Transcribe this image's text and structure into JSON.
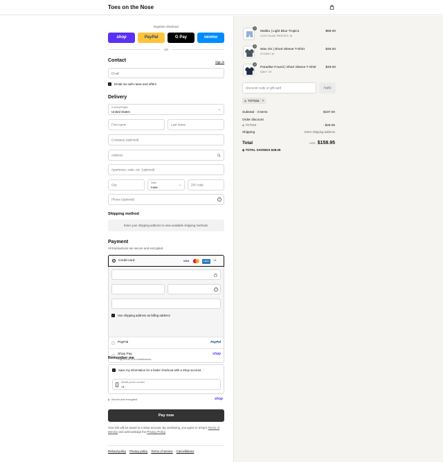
{
  "header": {
    "brand": "Toes on the Nose",
    "cart_icon": "shopping-bag-icon"
  },
  "express": {
    "label": "Express checkout",
    "buttons": [
      {
        "label": "shop",
        "color": "#5a31f4"
      },
      {
        "label": "PayPal",
        "color": "#ffc439"
      },
      {
        "label": "G Pay",
        "color": "#000000"
      },
      {
        "label": "venmo",
        "color": "#008cff"
      }
    ],
    "or": "OR"
  },
  "contact": {
    "title": "Contact",
    "signin": "Sign in",
    "email_placeholder": "Email",
    "news_label": "Email me with news and offers"
  },
  "delivery": {
    "title": "Delivery",
    "country_label": "Country/Region",
    "country_value": "United States",
    "first_name": "First name",
    "last_name": "Last name",
    "company": "Company (optional)",
    "address": "Address",
    "apartment": "Apartment, suite, etc. (optional)",
    "city": "City",
    "state_label": "State",
    "state_value": "Iowa",
    "zip": "ZIP code",
    "phone": "Phone (optional)"
  },
  "shipping": {
    "title": "Shipping method",
    "notice": "Enter your shipping address to view available shipping methods."
  },
  "payment": {
    "title": "Payment",
    "subtitle": "All transactions are secure and encrypted.",
    "credit_card": "Credit card",
    "card_badges": [
      "VISA",
      "MC",
      "AMEX",
      "+4"
    ],
    "billing_same": "Use shipping address as billing address",
    "paypal": "PayPal",
    "paypal_logo": "PayPal",
    "shoppay": "Shop Pay",
    "shoppay_sub": "Pay in full or in installments",
    "shoppay_logo": "shop"
  },
  "remember": {
    "title": "Remember me",
    "save_label": "Save my information for a faster checkout with a Shop account",
    "mobile_label": "Mobile phone number",
    "mobile_value": "+1",
    "secure": "Secure and encrypted",
    "shop_logo": "shop"
  },
  "pay_now": "Pay now",
  "legal": {
    "text_1": "Your info will be saved to a Shop account. By continuing, you agree to Shop's",
    "terms": "Terms of Service",
    "text_2": "and acknowledge the",
    "privacy": "Privacy Policy",
    "text_3": "."
  },
  "footer_links": [
    "Refund policy",
    "Privacy policy",
    "Terms of service",
    "Cancellations"
  ],
  "cart": {
    "items": [
      {
        "title": "Malibu | Light Blue Tropics",
        "variant": "LIGHT BLUE TROPICS / M",
        "price": "$89.00",
        "qty": "1",
        "color": "#8fb3d9"
      },
      {
        "title": "Wax On | Short Sleeve T-Shirt",
        "variant": "STORM / M",
        "price": "$49.00",
        "qty": "1",
        "color": "#4a5560"
      },
      {
        "title": "Paradise Found | Short Sleeve T-Shirt",
        "variant": "NAVY / M",
        "price": "$49.00",
        "qty": "1",
        "color": "#1f2a44"
      }
    ],
    "discount_placeholder": "Discount code or gift card",
    "apply": "Apply",
    "code": "TOTN15",
    "subtotal_label": "Subtotal · 3 items",
    "subtotal_value": "$187.00",
    "order_discount": "Order discount",
    "discount_code": "TOTN15",
    "discount_value": "- $28.05",
    "shipping_label": "Shipping",
    "shipping_value": "Enter shipping address",
    "total_label": "Total",
    "currency": "USD",
    "total_value": "$158.95",
    "savings_label": "TOTAL SAVINGS",
    "savings_value": "$28.05"
  }
}
